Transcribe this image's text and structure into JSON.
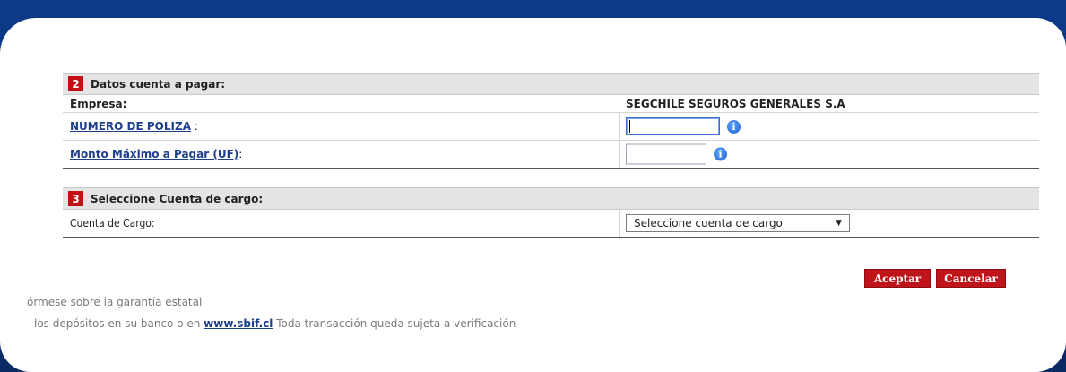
{
  "section2": {
    "number": "2",
    "title": "Datos cuenta a pagar:",
    "rows": [
      {
        "label": "Empresa:",
        "value": "SEGCHILE SEGUROS GENERALES S.A"
      },
      {
        "label_link": "NUMERO DE POLIZA",
        "label_suffix": " :",
        "value": "",
        "info_icon": "info-icon"
      },
      {
        "label_link": "Monto Máximo a Pagar (UF)",
        "label_suffix": ":",
        "value": "",
        "info_icon": "info-icon"
      }
    ]
  },
  "section3": {
    "number": "3",
    "title": "Seleccione Cuenta de cargo:",
    "row": {
      "label": "Cuenta de Cargo:",
      "select_value": "Seleccione cuenta de cargo",
      "arrow": "▼"
    }
  },
  "buttons": {
    "accept": "Aceptar",
    "cancel": "Cancelar"
  },
  "footer": {
    "line1": "órmese sobre la garantía estatal",
    "line2_before": "los depósitos en su banco o en ",
    "line2_link": "www.sbif.cl",
    "line2_after": " Toda transacción queda sujeta a verificación"
  },
  "colors": {
    "background": "#0d3b8a",
    "accent_red": "#c0141b",
    "link_blue": "#1f3e8c"
  }
}
